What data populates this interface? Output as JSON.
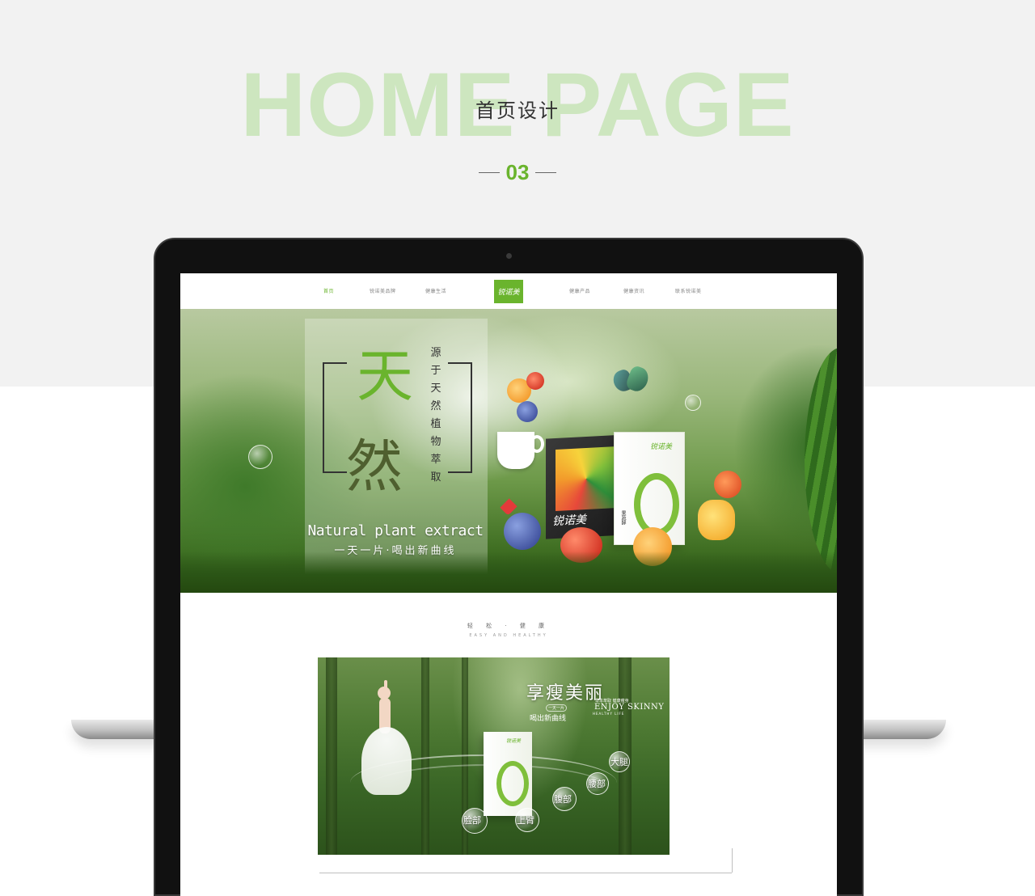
{
  "heading": {
    "big": "HOME PAGE",
    "sub": "首页设计",
    "number": "03"
  },
  "site": {
    "nav": {
      "items": [
        "首页",
        "锐诺美品牌",
        "健康生活",
        "健康产品",
        "健康资讯",
        "联系锐诺美"
      ],
      "active_index": 0,
      "logo": "锐诺美",
      "accent": "#6ab42d"
    },
    "banner": {
      "char1": "天",
      "char2": "然",
      "vertical": "源于天然植物萃取",
      "en": "Natural plant extract",
      "cn": "一天一片·喝出新曲线",
      "product_dark_label": "锐诺美",
      "product_white_logo": "锐诺美",
      "product_tag": "果蔬酵"
    },
    "section": {
      "title": "轻 松 · 健 康",
      "subtitle": "EASY AND HEALTHY"
    },
    "card": {
      "title": "享瘦美丽",
      "tagline": "草本萃取 健康瘦身",
      "en": "ENJOY SKINNY",
      "life": "HEALTHY LIFE",
      "one_one": "一天一片",
      "drink": "喝出新曲线",
      "product_logo": "锐诺美",
      "bubbles": [
        "脸部",
        "上臂",
        "腹部",
        "腰部",
        "大腿"
      ]
    }
  }
}
